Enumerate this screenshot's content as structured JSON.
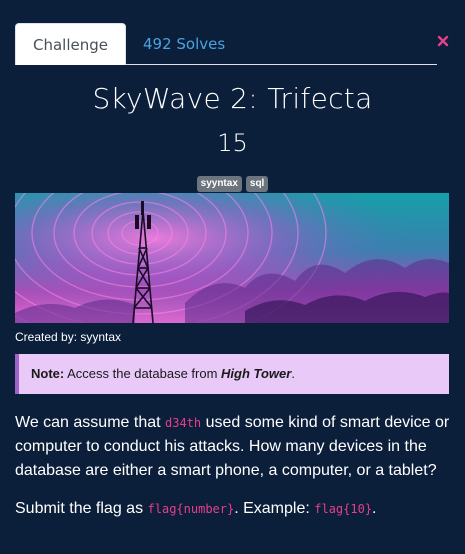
{
  "tabs": {
    "challenge": "Challenge",
    "solves": "492 Solves"
  },
  "challenge": {
    "name": "SkyWave 2: Trifecta",
    "value": "15",
    "tags": [
      "syyntax",
      "sql"
    ],
    "author": "Created by: syyntax"
  },
  "note": {
    "label": "Note:",
    "text_before": " Access the database from ",
    "emphasis": "High Tower",
    "text_after": "."
  },
  "description": {
    "p1_before": "We can assume that ",
    "p1_code": "d34th",
    "p1_after": " used some kind of smart device or computer to conduct his attacks. How many devices in the database are either a smart phone, a computer, or a tablet?",
    "p2_before": "Submit the flag as ",
    "p2_code1": "flag{number}",
    "p2_mid": ". Example: ",
    "p2_code2": "flag{10}",
    "p2_after": "."
  },
  "colors": {
    "background": "#0b1f3a",
    "tab_link": "#4aa3df",
    "close": "#e83e8c",
    "note_bg": "#e8c9f7",
    "code": "#e83e8c"
  },
  "icons": {
    "close": "close-icon"
  }
}
